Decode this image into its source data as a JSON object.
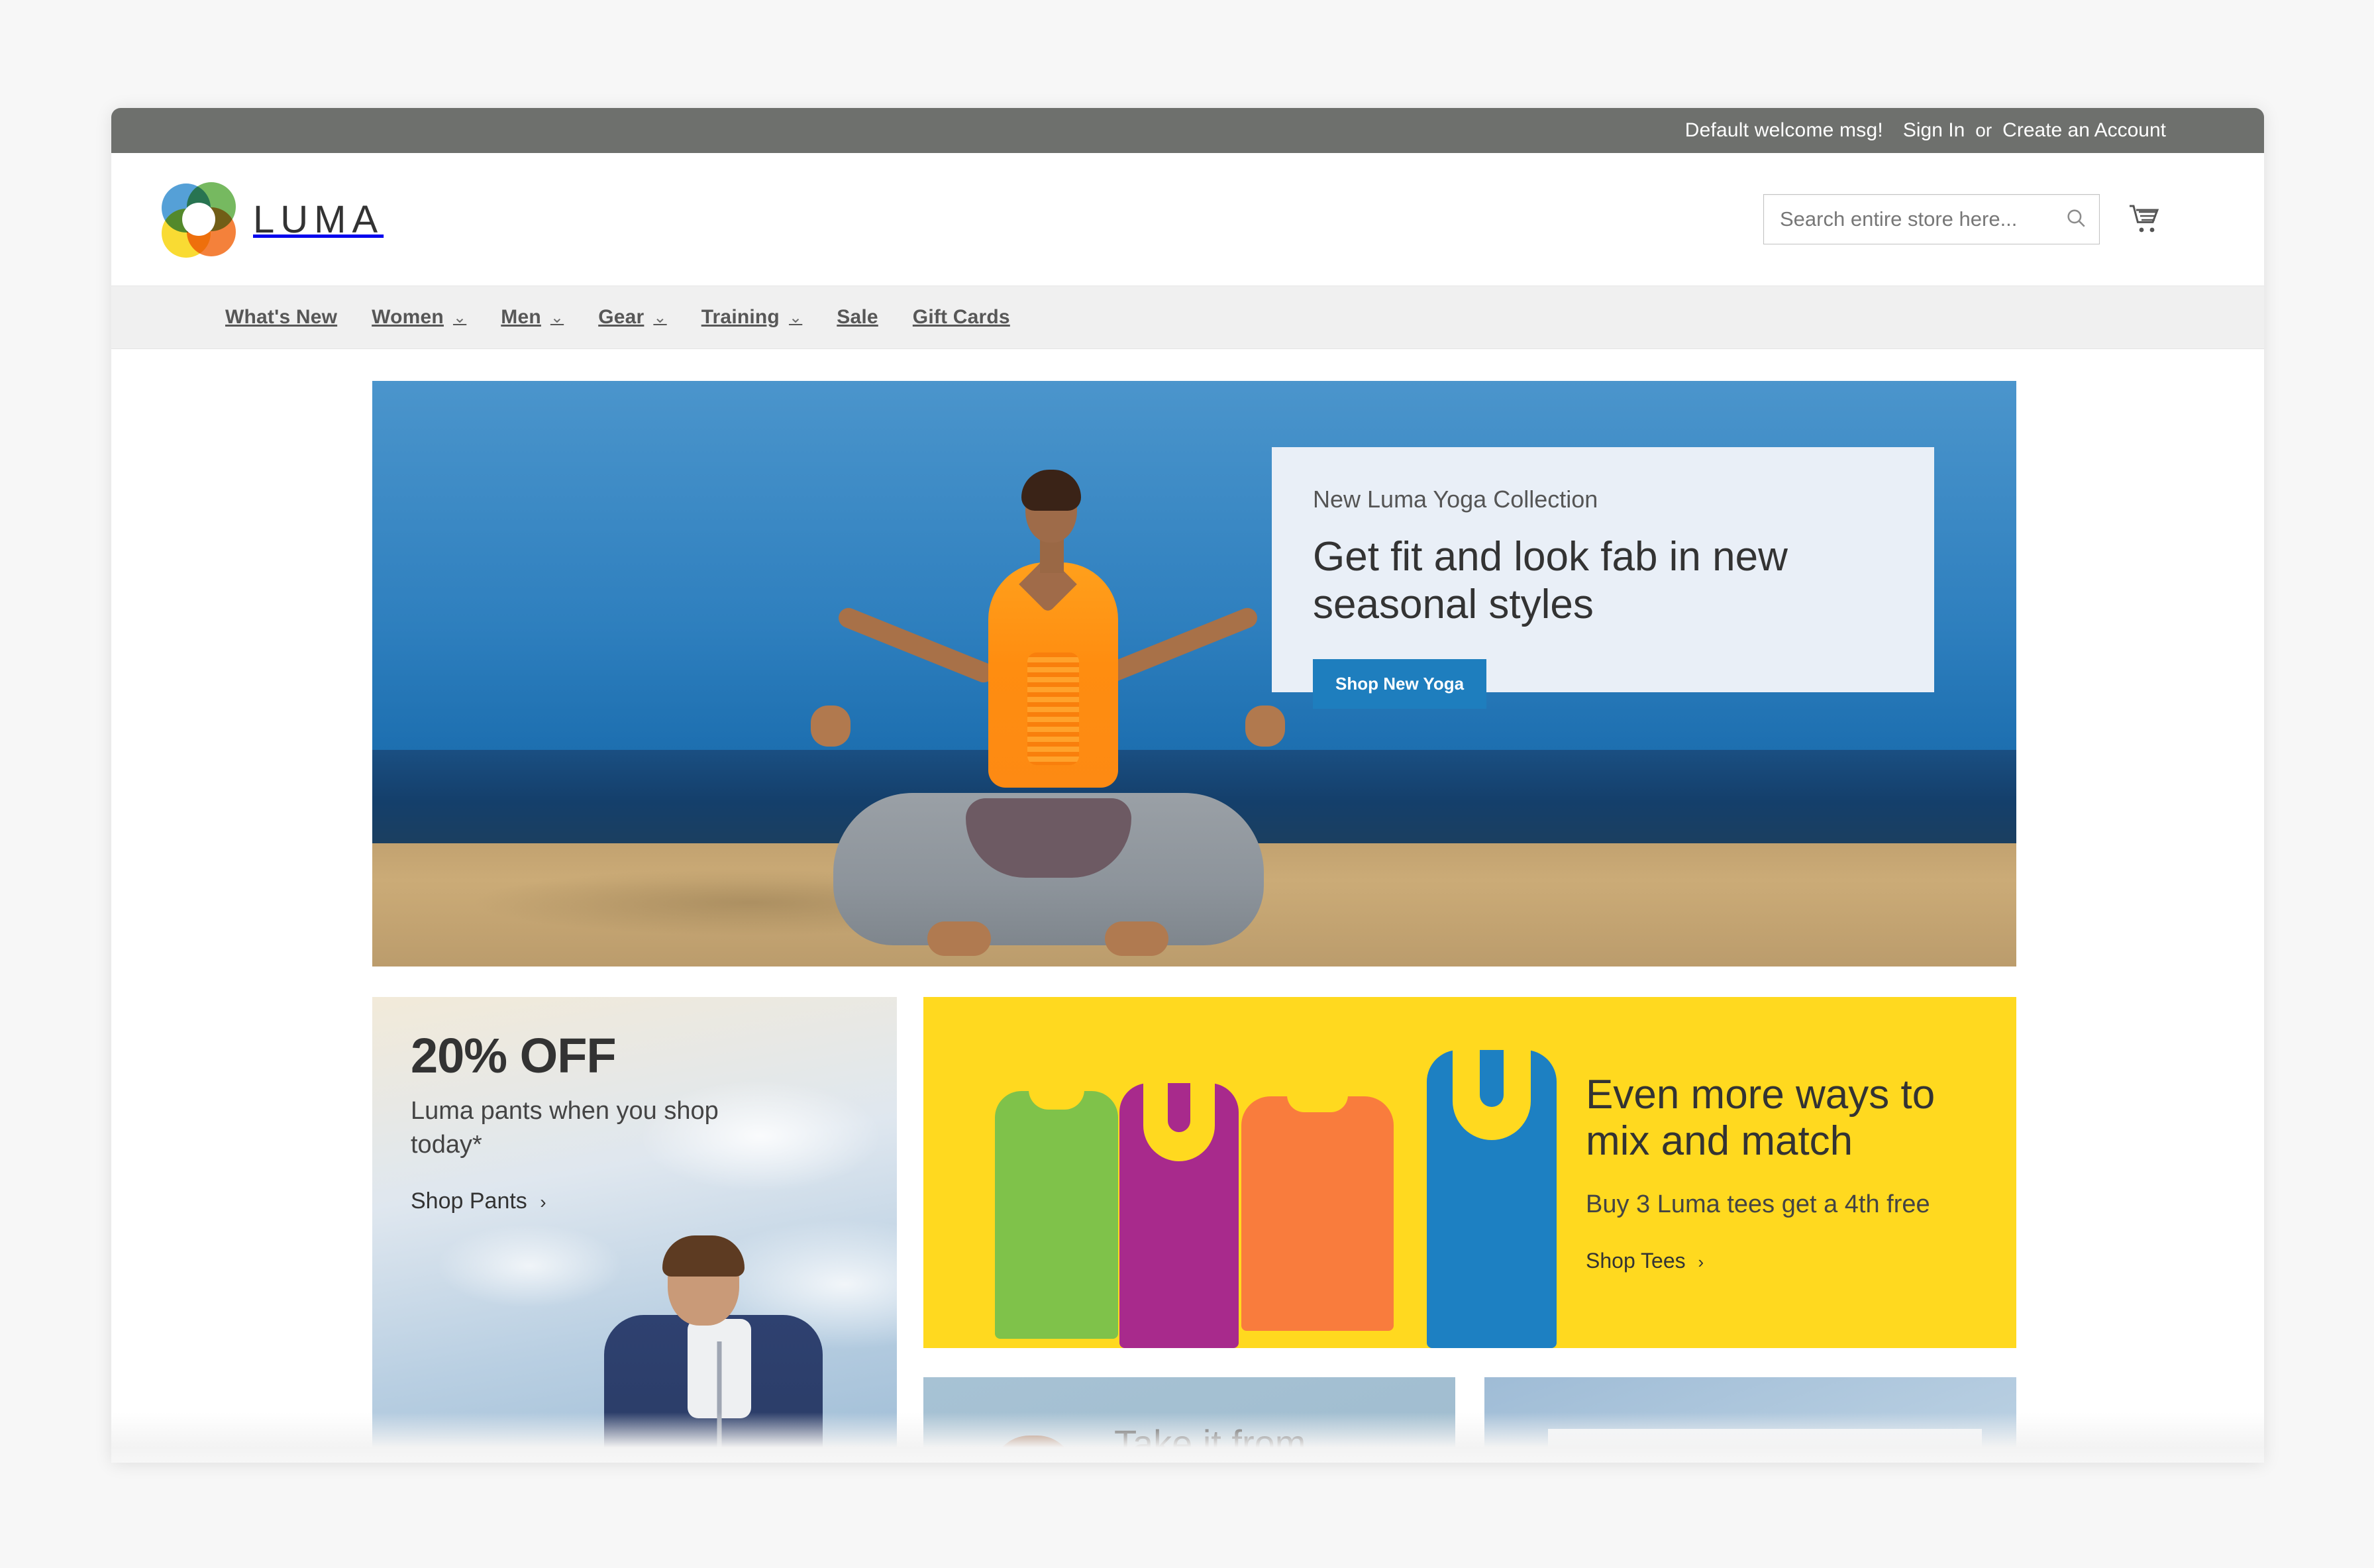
{
  "topbar": {
    "welcome": "Default welcome msg!",
    "sign_in": "Sign In",
    "separator": "or",
    "create_account": "Create an Account"
  },
  "header": {
    "brand_name": "LUMA",
    "search": {
      "placeholder": "Search entire store here...",
      "value": "",
      "icon": "search-icon"
    },
    "cart_icon": "shopping-cart-icon"
  },
  "nav": {
    "items": [
      {
        "label": "What's New",
        "has_dropdown": false
      },
      {
        "label": "Women",
        "has_dropdown": true
      },
      {
        "label": "Men",
        "has_dropdown": true
      },
      {
        "label": "Gear",
        "has_dropdown": true
      },
      {
        "label": "Training",
        "has_dropdown": true
      },
      {
        "label": "Sale",
        "has_dropdown": false
      },
      {
        "label": "Gift Cards",
        "has_dropdown": false
      }
    ],
    "caret": "⌄"
  },
  "hero": {
    "eyebrow": "New Luma Yoga Collection",
    "title": "Get fit and look fab in new seasonal styles",
    "button_label": "Shop New Yoga",
    "image_alt": "Woman meditating in lotus pose on a beach wearing an orange top and grey leggings"
  },
  "promos": {
    "pants": {
      "headline": "20% OFF",
      "subtext": "Luma pants when you shop today*",
      "cta": "Shop Pants",
      "chevron": "›",
      "image_alt": "Man in navy zip hoodie against a cloudy sky"
    },
    "tees": {
      "headline": "Even more ways to mix and match",
      "subtext": "Buy 3 Luma tees get a 4th free",
      "cta": "Shop Tees",
      "chevron": "›",
      "image_alt": "Four colored tees and tanks on a yellow background"
    },
    "quote": {
      "headline": "Take it from"
    },
    "erin": {
      "quote_mark": "“"
    }
  },
  "colors": {
    "topbar_bg": "#6e706d",
    "nav_bg": "#f0f0f0",
    "accent_blue": "#1e7ebe",
    "promo_yellow": "#ffd91f",
    "tee_green": "#7fc24a",
    "tee_magenta": "#a82a8c",
    "tee_orange": "#f97c3d",
    "tee_blue": "#1d80c2",
    "hero_card_bg": "#e9eff7"
  }
}
